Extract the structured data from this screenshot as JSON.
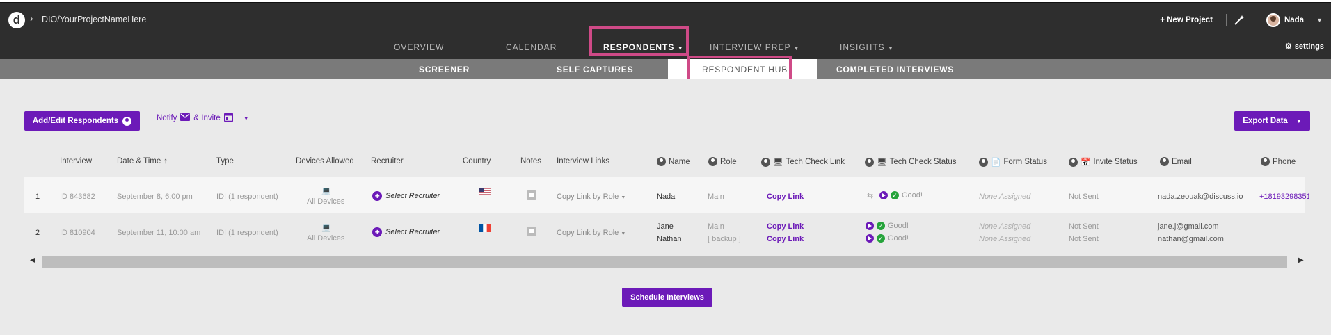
{
  "header": {
    "breadcrumb": "DIO/YourProjectNameHere",
    "new_project": "+ New Project",
    "user_name": "Nada",
    "settings": "settings"
  },
  "main_nav": {
    "overview": "OVERVIEW",
    "calendar": "CALENDAR",
    "respondents": "RESPONDENTS",
    "interview_prep": "INTERVIEW PREP",
    "insights": "INSIGHTS"
  },
  "sub_nav": {
    "screener": "SCREENER",
    "self_captures": "SELF CAPTURES",
    "respondent_hub": "RESPONDENT HUB",
    "completed_interviews": "COMPLETED INTERVIEWS"
  },
  "toolbar": {
    "add_edit": "Add/Edit Respondents",
    "notify": "Notify",
    "invite": "& Invite",
    "export": "Export Data",
    "schedule": "Schedule Interviews"
  },
  "columns": {
    "interview": "Interview",
    "date_time": "Date & Time",
    "type": "Type",
    "devices": "Devices Allowed",
    "recruiter": "Recruiter",
    "country": "Country",
    "notes": "Notes",
    "links": "Interview Links",
    "name": "Name",
    "role": "Role",
    "tech_link": "Tech Check Link",
    "tech_status": "Tech Check Status",
    "form_status": "Form Status",
    "invite_status": "Invite Status",
    "email": "Email",
    "phone": "Phone"
  },
  "rows": [
    {
      "num": "1",
      "interview": "ID 843682",
      "date": "September 8, 6:00 pm",
      "type": "IDI (1 respondent)",
      "devices": "All Devices",
      "recruiter": "Select Recruiter",
      "country_flag": "us",
      "links": "Copy Link by Role",
      "names": [
        "Nada"
      ],
      "roles": [
        "Main"
      ],
      "tech_links": [
        "Copy Link"
      ],
      "tech_status": [
        "Good!"
      ],
      "form_status": [
        "None Assigned"
      ],
      "invite_status": [
        "Not Sent"
      ],
      "emails": [
        "nada.zeouak@discuss.io"
      ],
      "phone": "+18193298351"
    },
    {
      "num": "2",
      "interview": "ID 810904",
      "date": "September 11, 10:00 am",
      "type": "IDI (1 respondent)",
      "devices": "All Devices",
      "recruiter": "Select Recruiter",
      "country_flag": "fr",
      "links": "Copy Link by Role",
      "names": [
        "Jane",
        "Nathan"
      ],
      "roles": [
        "Main",
        "[ backup ]"
      ],
      "tech_links": [
        "Copy Link",
        "Copy Link"
      ],
      "tech_status": [
        "Good!",
        "Good!"
      ],
      "form_status": [
        "None Assigned",
        "None Assigned"
      ],
      "invite_status": [
        "Not Sent",
        "Not Sent"
      ],
      "emails": [
        "jane.j@gmail.com",
        "nathan@gmail.com"
      ],
      "phone": ""
    }
  ],
  "colors": {
    "accent": "#6c1ab8",
    "highlight": "#cf4a87",
    "header_bg": "#2e2e2e"
  }
}
